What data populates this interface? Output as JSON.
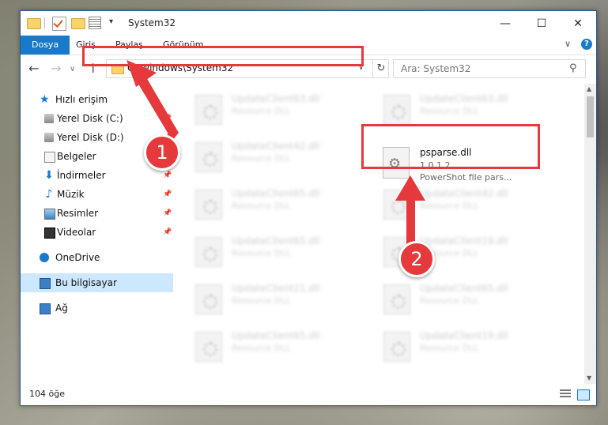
{
  "window": {
    "title": "System32",
    "controls": {
      "minimize": "—",
      "maximize": "☐",
      "close": "✕"
    },
    "quick_access_dropdown": "▾"
  },
  "ribbon": {
    "tabs": [
      "Dosya",
      "Giriş",
      "Paylaş",
      "Görünüm"
    ],
    "collapse_glyph": "∨",
    "help_glyph": "?"
  },
  "navigation": {
    "back_glyph": "←",
    "forward_glyph": "→",
    "recent_glyph": "∨",
    "up_glyph": "↑",
    "address": "C:\\Windows\\System32",
    "address_dropdown_glyph": "∨",
    "refresh_glyph": "↻",
    "search_placeholder": "Ara: System32",
    "search_glyph": "⚲"
  },
  "nav_pane": {
    "quick_access": "Hızlı erişim",
    "items": [
      {
        "label": "Yerel Disk (C:)",
        "icon": "drive-icon",
        "pinned": true
      },
      {
        "label": "Yerel Disk (D:)",
        "icon": "drive-icon",
        "pinned": true
      },
      {
        "label": "Belgeler",
        "icon": "documents-icon",
        "pinned": true
      },
      {
        "label": "İndirmeler",
        "icon": "downloads-icon",
        "pinned": true
      },
      {
        "label": "Müzik",
        "icon": "music-icon",
        "pinned": true
      },
      {
        "label": "Resimler",
        "icon": "pictures-icon",
        "pinned": true
      },
      {
        "label": "Videolar",
        "icon": "videos-icon",
        "pinned": true
      }
    ],
    "onedrive": "OneDrive",
    "this_pc": "Bu bilgisayar",
    "network": "Ağ",
    "pin_glyph": "📌"
  },
  "files": {
    "left_column": [
      {
        "name": "UpdateClient63.dll",
        "desc": "Resource DLL"
      },
      {
        "name": "UpdateClient42.dll",
        "desc": "Resource DLL"
      },
      {
        "name": "UpdateClient65.dll",
        "desc": "Resource DLL"
      },
      {
        "name": "UpdateClient65.dll",
        "desc": "Resource DLL"
      },
      {
        "name": "UpdateClient21.dll",
        "desc": "Resource DLL"
      },
      {
        "name": "UpdateClient65.dll",
        "desc": "Resource DLL"
      }
    ],
    "right_column": [
      {
        "name": "UpdateClient63.dll",
        "desc": "Resource DLL"
      },
      {
        "name": "UpdateClient42.dll",
        "desc": "Resource DLL"
      },
      {
        "name": "UpdateClient19.dll",
        "desc": "Resource DLL"
      },
      {
        "name": "UpdateClient65.dll",
        "desc": "Resource DLL"
      },
      {
        "name": "UpdateClient19.dll",
        "desc": "Resource DLL"
      }
    ],
    "highlighted": {
      "name": "psparse.dll",
      "version": "1.0.1.2",
      "description": "PowerShot file pars..."
    }
  },
  "status_bar": {
    "item_count": "104 öğe"
  },
  "annotations": {
    "step1": "1",
    "step2": "2",
    "color": "#e5393b"
  },
  "colors": {
    "accent": "#1979ca",
    "selection": "#cce8ff"
  }
}
